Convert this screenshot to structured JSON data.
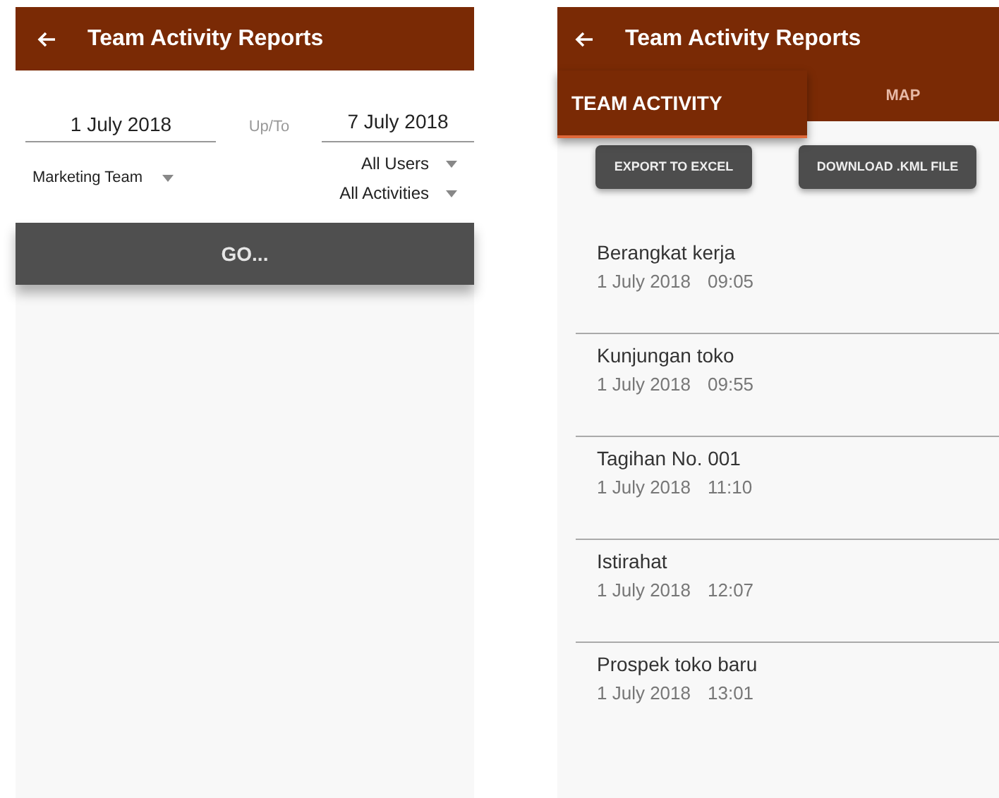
{
  "screens": [
    {
      "kind": "filter",
      "title": "Team Activity Reports",
      "date_from": "1 July 2018",
      "separator": "Up/To",
      "date_to": "7 July 2018",
      "team": "Marketing Team",
      "user": "All Users",
      "activity": "All Activities",
      "go": "GO..."
    },
    {
      "kind": "list",
      "title": "Team Activity Reports",
      "tabs": [
        {
          "label": "TEAM ACTIVITY",
          "selected": true
        },
        {
          "label": "MAP",
          "selected": false
        }
      ],
      "buttons": [
        "EXPORT TO EXCEL",
        "DOWNLOAD .KML FILE"
      ],
      "activities": [
        {
          "name": "Berangkat kerja",
          "date": "1 July 2018",
          "time": "09:05"
        },
        {
          "name": "Kunjungan toko",
          "date": "1 July 2018",
          "time": "09:55"
        },
        {
          "name": "Tagihan No. 001",
          "date": "1 July 2018",
          "time": "11:10"
        },
        {
          "name": "Istirahat",
          "date": "1 July 2018",
          "time": "12:07"
        },
        {
          "name": "Prospek toko baru",
          "date": "1 July 2018",
          "time": "13:01"
        }
      ]
    }
  ]
}
